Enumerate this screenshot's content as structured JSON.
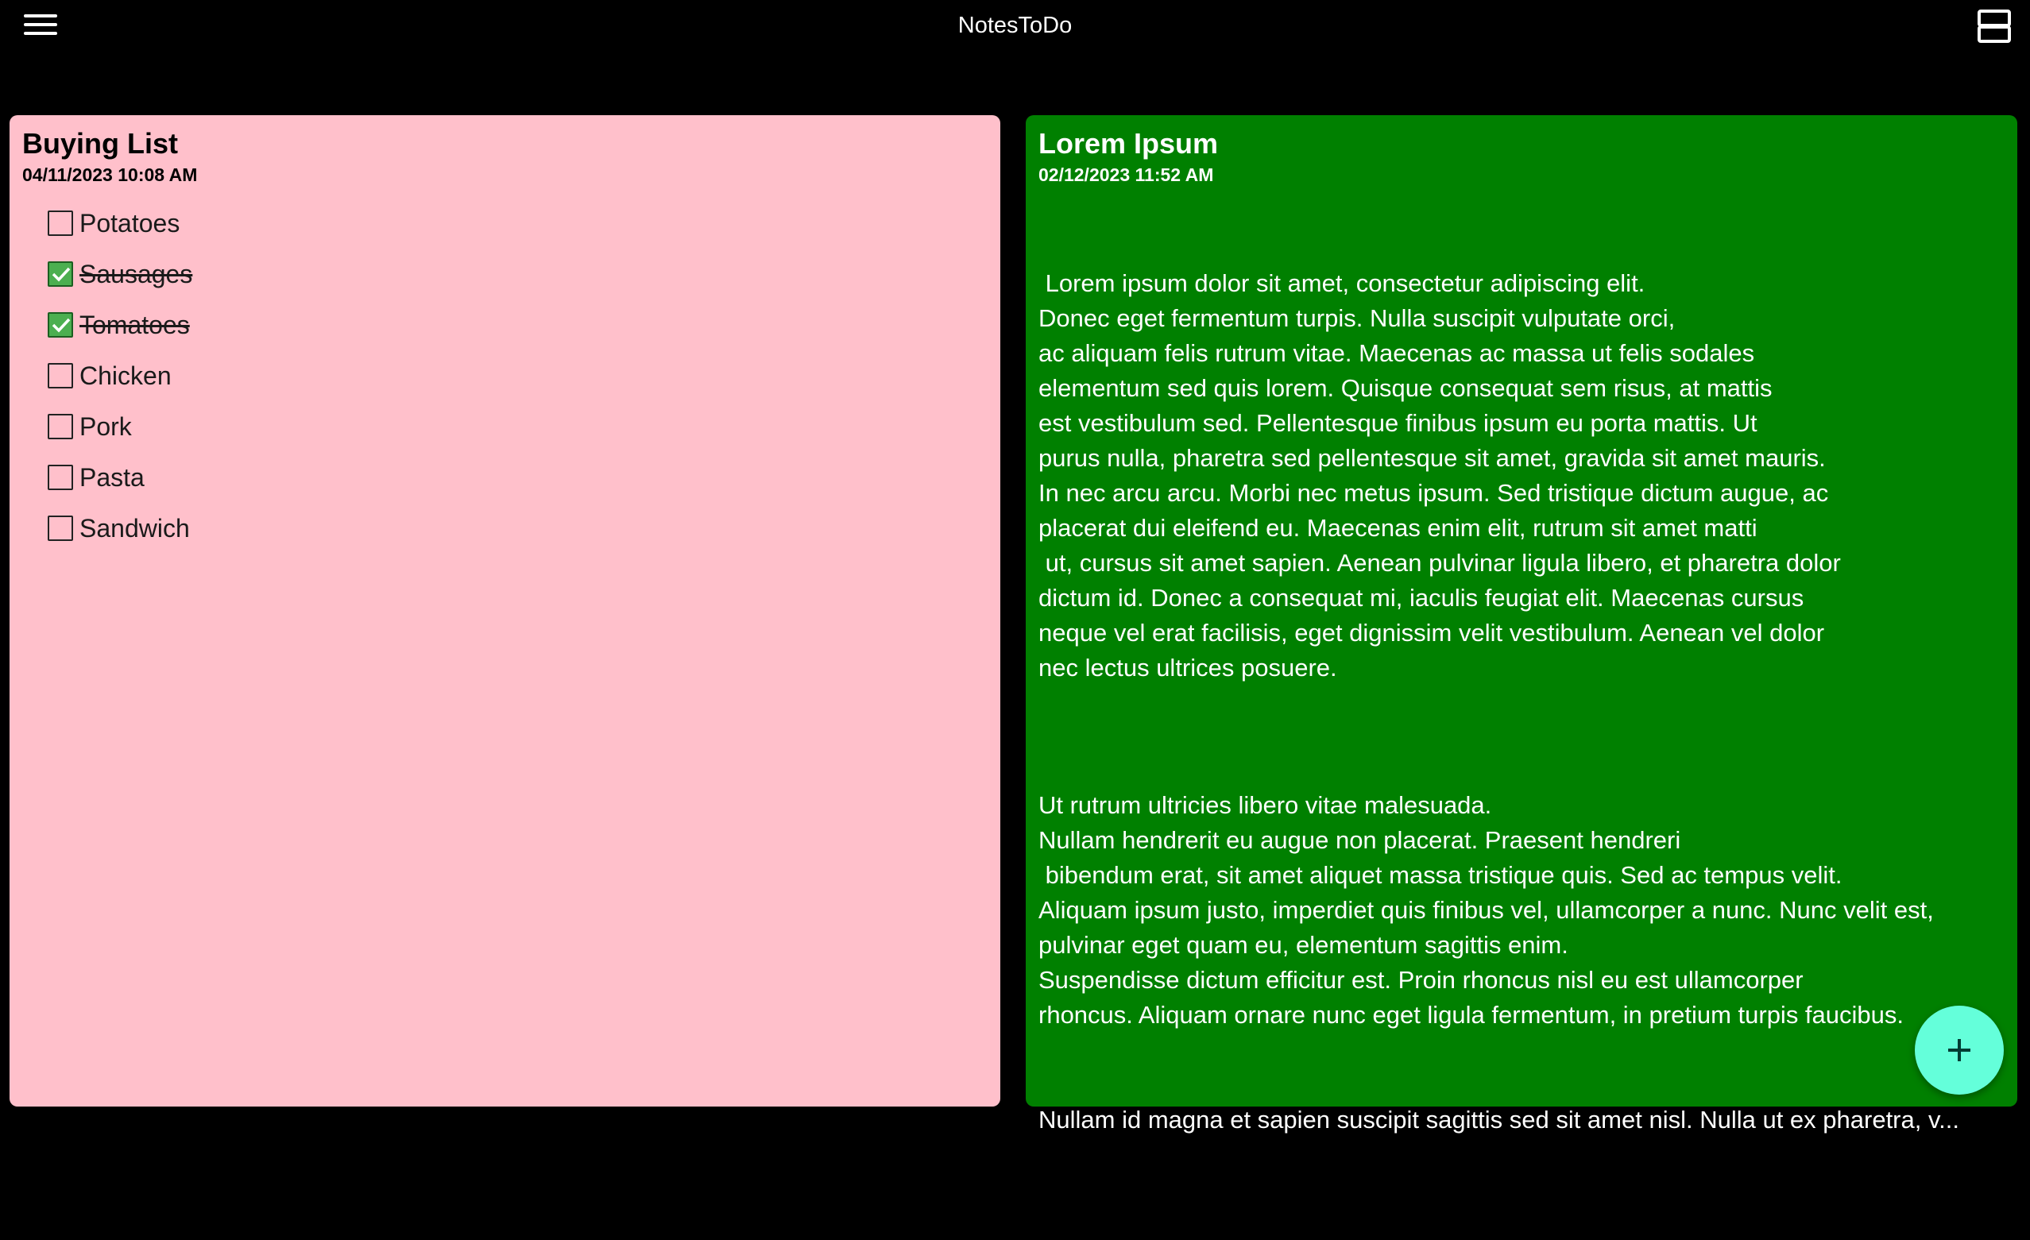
{
  "app": {
    "title": "NotesToDo",
    "menu_icon": "hamburger-menu-icon",
    "layout_icon": "view-agenda-icon"
  },
  "notes": [
    {
      "title": "Buying List",
      "date": "04/11/2023 10:08 AM",
      "color": "#ffc0cb",
      "items": [
        {
          "label": "Potatoes",
          "checked": false
        },
        {
          "label": "Sausages",
          "checked": true
        },
        {
          "label": "Tomatoes",
          "checked": true
        },
        {
          "label": "Chicken",
          "checked": false
        },
        {
          "label": "Pork",
          "checked": false
        },
        {
          "label": "Pasta",
          "checked": false
        },
        {
          "label": "Sandwich",
          "checked": false
        }
      ]
    },
    {
      "title": "Lorem Ipsum",
      "date": "02/12/2023 11:52 AM",
      "color": "#008000",
      "paragraph1": " Lorem ipsum dolor sit amet, consectetur adipiscing elit.\nDonec eget fermentum turpis. Nulla suscipit vulputate orci,\nac aliquam felis rutrum vitae. Maecenas ac massa ut felis sodales\nelementum sed quis lorem. Quisque consequat sem risus, at mattis\nest vestibulum sed. Pellentesque finibus ipsum eu porta mattis. Ut\npurus nulla, pharetra sed pellentesque sit amet, gravida sit amet mauris.\nIn nec arcu arcu. Morbi nec metus ipsum. Sed tristique dictum augue, ac\nplacerat dui eleifend eu. Maecenas enim elit, rutrum sit amet matti\n ut, cursus sit amet sapien. Aenean pulvinar ligula libero, et pharetra dolor\ndictum id. Donec a consequat mi, iaculis feugiat elit. Maecenas cursus\nneque vel erat facilisis, eget dignissim velit vestibulum. Aenean vel dolor\nnec lectus ultrices posuere.",
      "paragraph2": "Ut rutrum ultricies libero vitae malesuada.\nNullam hendrerit eu augue non placerat. Praesent hendreri\n bibendum erat, sit amet aliquet massa tristique quis. Sed ac tempus velit.\nAliquam ipsum justo, imperdiet quis finibus vel, ullamcorper a nunc. Nunc velit est,\npulvinar eget quam eu, elementum sagittis enim.\nSuspendisse dictum efficitur est. Proin rhoncus nisl eu est ullamcorper\nrhoncus. Aliquam ornare nunc eget ligula fermentum, in pretium turpis faucibus.",
      "last_line": "Nullam id magna et sapien suscipit sagittis sed sit amet nisl. Nulla ut ex pharetra, v..."
    }
  ],
  "fab": {
    "icon": "plus-icon",
    "color": "#64ffda"
  }
}
